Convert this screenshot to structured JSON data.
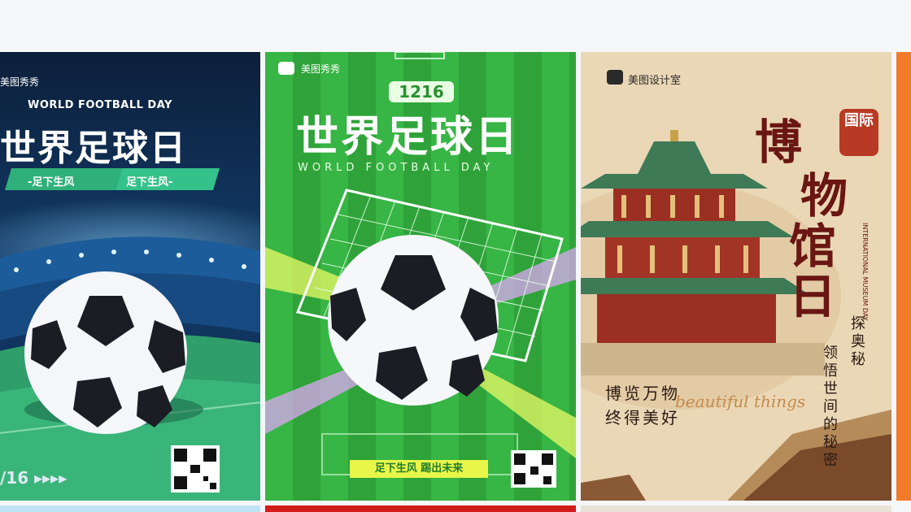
{
  "cards": [
    {
      "brand": "美图秀秀",
      "subtitle_en": "WORLD FOOTBALL DAY",
      "title": "世界足球日",
      "tags": [
        "-足下生风",
        "足下生风-"
      ],
      "date": "/16 ▸▸▸▸"
    },
    {
      "brand": "美图秀秀",
      "badge": "1216",
      "title": "世界足球日",
      "subtitle_en": "WORLD FOOTBALL DAY",
      "slogan": "足下生风 踢出未来"
    },
    {
      "brand": "美图设计室",
      "title_chars": [
        "博",
        "物",
        "馆",
        "日"
      ],
      "seal": "国际",
      "subtitle_en": "INTERNATIONAL MUSEUM DAY",
      "vertical_1": "探奥秘",
      "vertical_2": "领悟世间的秘密",
      "line_1": "博览万物",
      "line_2": "终得美好",
      "script": "beautiful things"
    }
  ],
  "colors": {
    "page_bg": "#f5f6f8",
    "football_blue": "#0c2a4a",
    "football_green": "#2fa33a",
    "museum_bg": "#ead7b6",
    "accent_orange": "#f27a2b"
  }
}
